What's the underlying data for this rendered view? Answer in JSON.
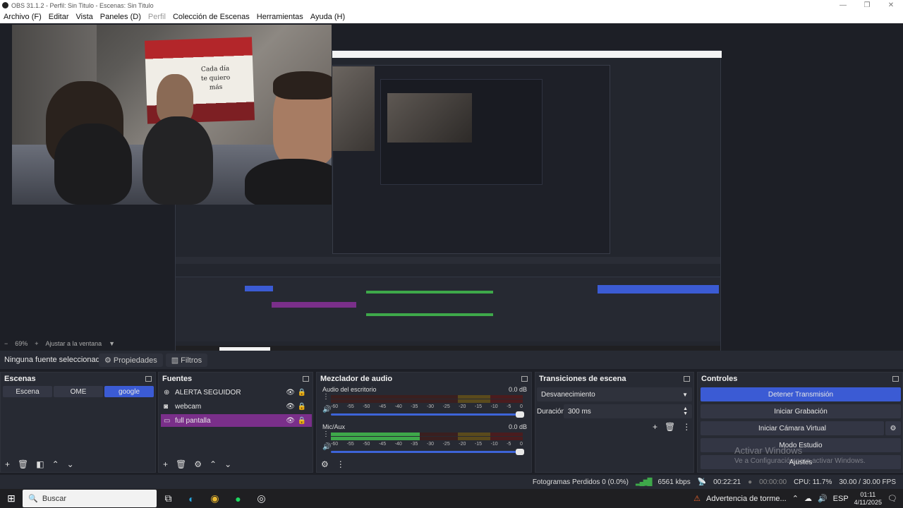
{
  "window": {
    "title": "OBS 31.1.2 - Perfil: Sin Titulo - Escenas: Sin Titulo"
  },
  "menu": [
    "Archivo (F)",
    "Editar",
    "Vista",
    "Paneles (D)",
    "Perfil",
    "Colección de Escenas",
    "Herramientas",
    "Ayuda (H)"
  ],
  "preview": {
    "flag_text": "Cada día\nte quiero\nmás",
    "zoom": "69%",
    "fit_label": "Ajustar a la ventana"
  },
  "props_bar": {
    "no_source": "Ninguna fuente seleccionada",
    "properties": "Propiedades",
    "filters": "Filtros"
  },
  "scenes": {
    "title": "Escenas",
    "items": [
      "Escena",
      "OME",
      "google"
    ],
    "active_index": 2
  },
  "sources": {
    "title": "Fuentes",
    "items": [
      {
        "label": "ALERTA SEGUIDOR",
        "icon": "browser-icon"
      },
      {
        "label": "webcam",
        "icon": "camera-icon"
      },
      {
        "label": "full pantalla",
        "icon": "monitor-icon"
      }
    ],
    "active_index": 2
  },
  "mixer": {
    "title": "Mezclador de audio",
    "channels": [
      {
        "name": "Audio del escritorio",
        "db": "0.0 dB",
        "level": 0.0
      },
      {
        "name": "Mic/Aux",
        "db": "0.0 dB",
        "level": 0.7
      }
    ],
    "ticks": [
      "-60",
      "-55",
      "-50",
      "-45",
      "-40",
      "-35",
      "-30",
      "-25",
      "-20",
      "-15",
      "-10",
      "-5",
      "0"
    ]
  },
  "transitions": {
    "title": "Transiciones de escena",
    "selected": "Desvanecimiento",
    "duration_label": "Duración",
    "duration_value": "300 ms"
  },
  "controls": {
    "title": "Controles",
    "stop_stream": "Detener Transmisión",
    "start_record": "Iniciar Grabación",
    "start_vcam": "Iniciar Cámara Virtual",
    "studio_mode": "Modo Estudio",
    "settings": "Ajustes"
  },
  "watermark": {
    "line1": "Activar Windows",
    "line2": "Ve a Configuración para activar Windows."
  },
  "status": {
    "dropped": "Fotogramas Perdidos 0 (0.0%)",
    "bitrate": "6561 kbps",
    "stream_time": "00:22:21",
    "rec_time": "00:00:00",
    "cpu": "CPU: 11.7%",
    "fps": "30.00 / 30.00 FPS"
  },
  "taskbar": {
    "search": "Buscar",
    "weather": "Advertencia de torme...",
    "lang": "ESP",
    "time": "01:11",
    "date": "4/11/2025"
  }
}
